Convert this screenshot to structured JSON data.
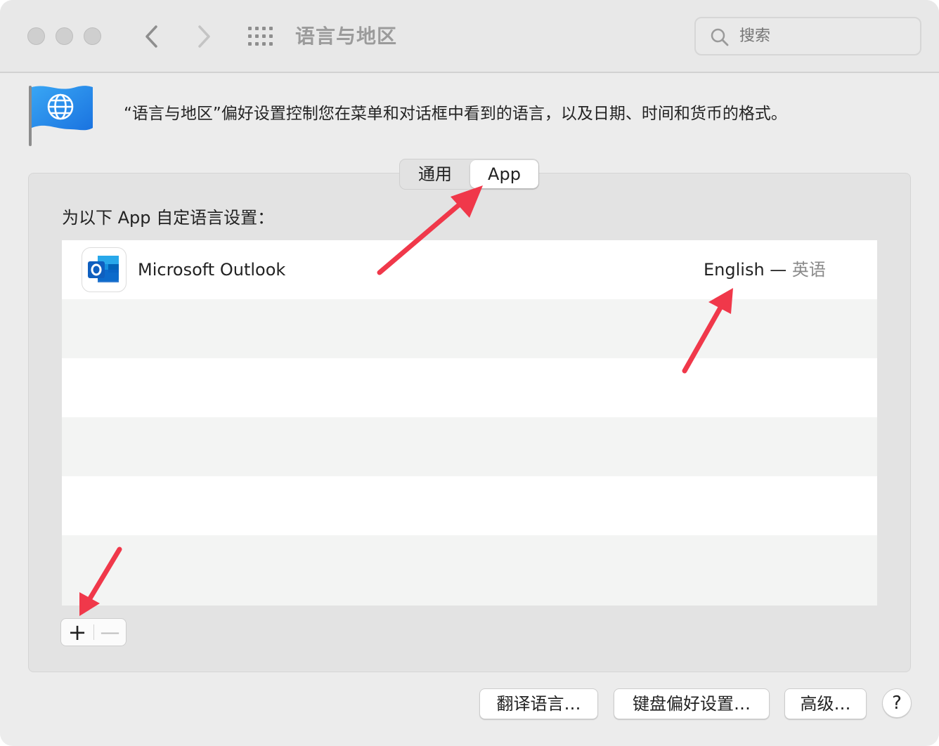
{
  "window": {
    "title": "语言与地区",
    "search_placeholder": "搜索"
  },
  "header": {
    "description": "“语言与地区”偏好设置控制您在菜单和对话框中看到的语言，以及日期、时间和货币的格式。"
  },
  "tabs": [
    {
      "label": "通用",
      "selected": false
    },
    {
      "label": "App",
      "selected": true
    }
  ],
  "panel": {
    "label": "为以下 App 自定语言设置：",
    "apps": [
      {
        "name": "Microsoft Outlook",
        "language": "English — ",
        "language_native": "英语",
        "icon": "outlook-icon"
      }
    ],
    "add_label": "+",
    "remove_label": "—"
  },
  "buttons": {
    "translate": "翻译语言…",
    "keyboard": "键盘偏好设置…",
    "advanced": "高级…",
    "help": "?"
  },
  "colors": {
    "annotation_arrow": "#f0384a",
    "outlook_blue": "#0a64c8"
  }
}
